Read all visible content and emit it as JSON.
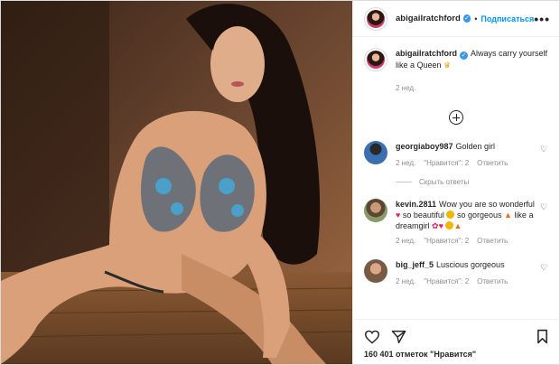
{
  "header": {
    "username": "abigailratchford",
    "follow_label": "Подписаться",
    "more_label": "•••"
  },
  "caption": {
    "username": "abigailratchford",
    "text": "Always carry yourself like a Queen",
    "time": "2 нед."
  },
  "comments": [
    {
      "username": "georgiaboy987",
      "text": "Golden girl",
      "time": "2 нед.",
      "likes": "\"Нравится\": 2",
      "reply": "Ответить"
    },
    {
      "username": "kevin.2811",
      "text_1": "Wow you are so wonderful",
      "text_2": "so beautiful",
      "text_3": "so gorgeous",
      "text_4": "like a dreamgirl",
      "time": "2 нед.",
      "likes": "\"Нравится\": 2",
      "reply": "Ответить"
    },
    {
      "username": "big_jeff_5",
      "text": "Luscious gorgeous",
      "time": "2 нед.",
      "likes": "\"Нравится\": 2",
      "reply": "Ответить"
    }
  ],
  "hide_replies": "Скрыть ответы",
  "likes_summary": "160 401 отметок \"Нравится\"",
  "colors": {
    "accent": "#0095f6",
    "verified": "#3897f0",
    "muted": "#8e8e8e",
    "border": "#dbdbdb"
  },
  "icons": [
    "verified-icon",
    "more-icon",
    "load-more-icon",
    "heart-icon",
    "share-icon",
    "bookmark-icon"
  ]
}
